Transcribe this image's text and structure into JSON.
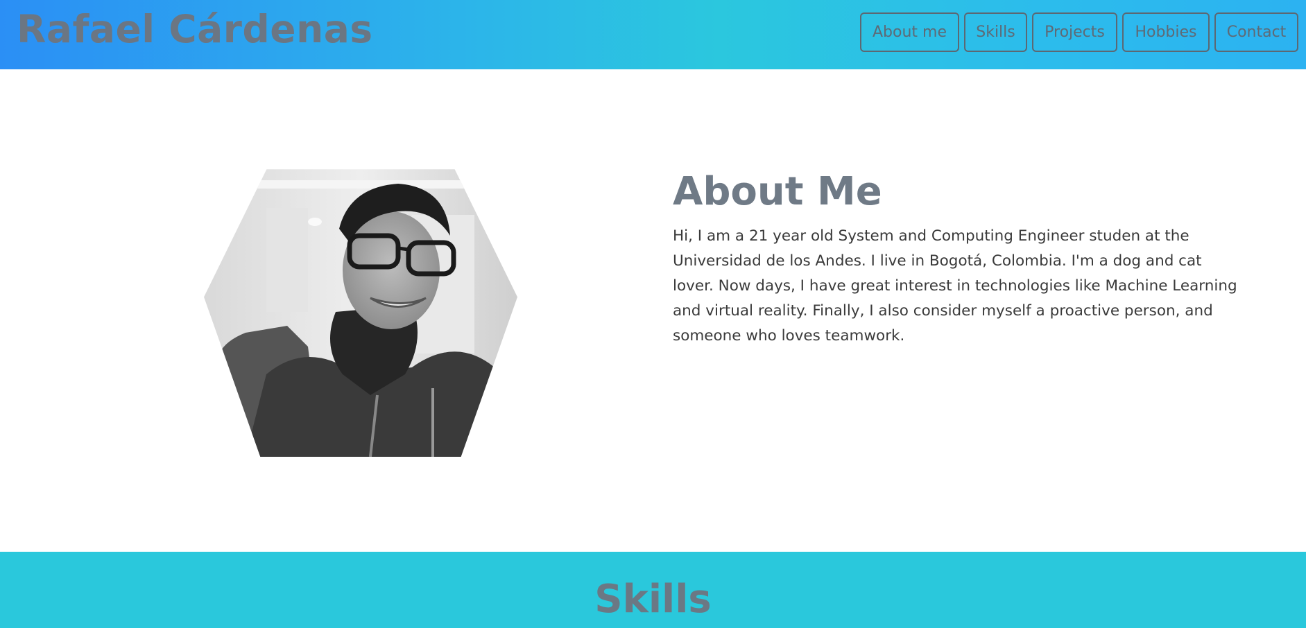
{
  "header": {
    "brand": "Rafael Cárdenas",
    "nav": [
      "About me",
      "Skills",
      "Projects",
      "Hobbies",
      "Contact"
    ]
  },
  "about": {
    "title": "About Me",
    "text": "Hi, I am a 21 year old System and Computing Engineer studen at the Universidad de los Andes. I live in Bogotá, Colombia. I'm a dog and cat lover. Now days, I have great interest in technologies like Machine Learning and virtual reality. Finally, I also consider myself a proactive person, and someone who loves teamwork.",
    "photo_alt": "portrait-photo"
  },
  "skills": {
    "title": "Skills"
  },
  "colors": {
    "header_gradient_start": "#2b8ff5",
    "header_gradient_end": "#2cb2f1",
    "skills_band": "#2ac8dc",
    "heading_gray": "#6f7a86"
  }
}
